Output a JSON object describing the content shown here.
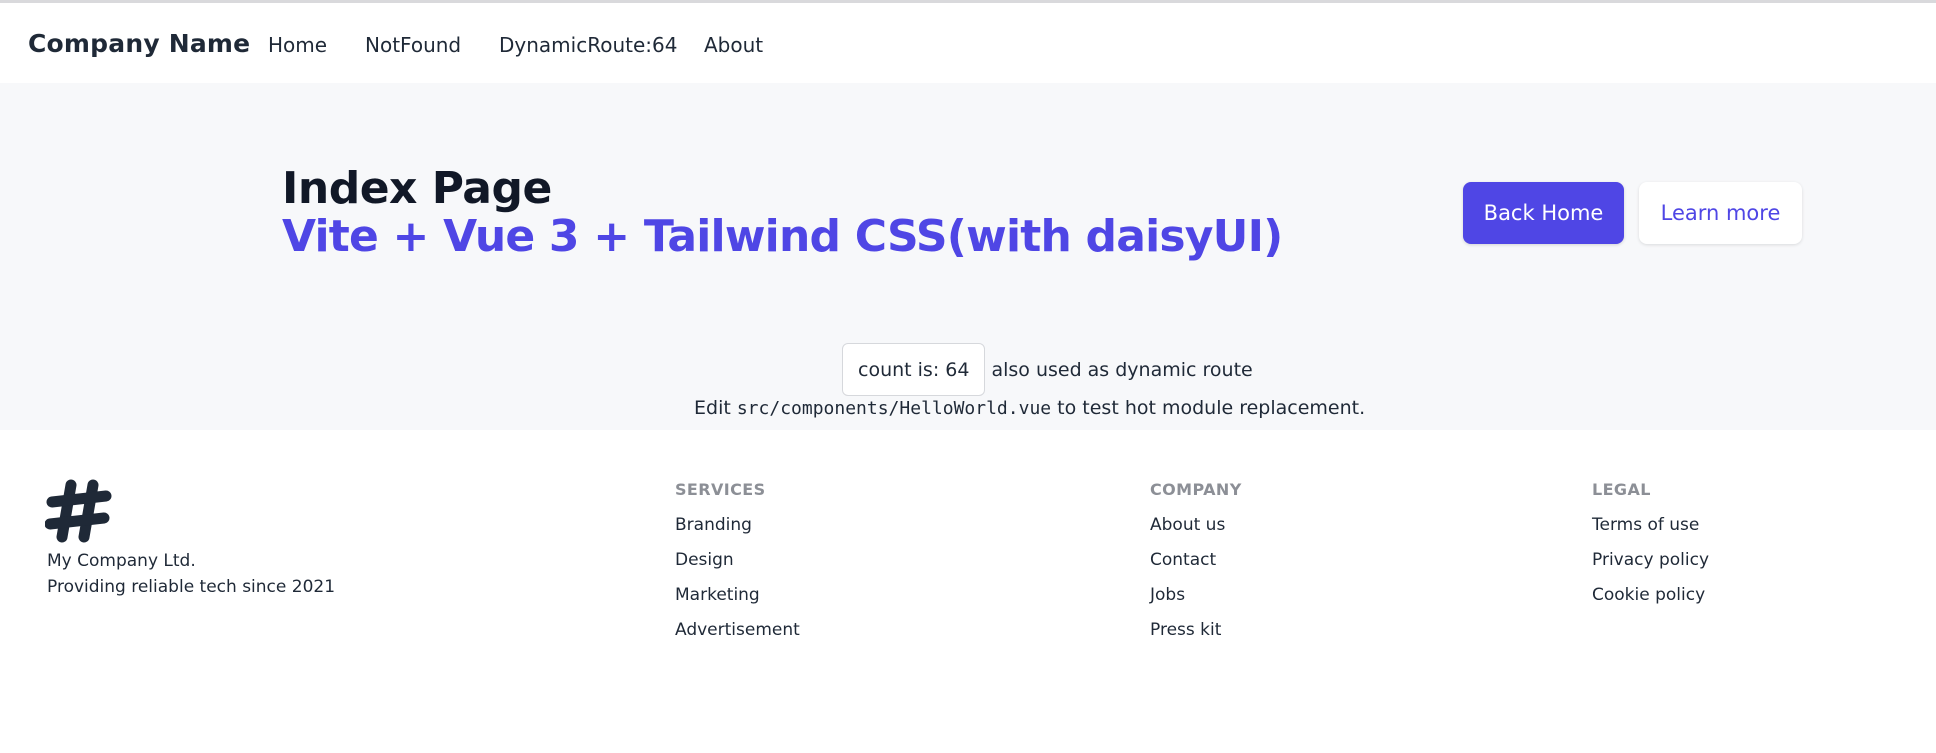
{
  "navbar": {
    "brand": "Company Name",
    "links": [
      "Home",
      "NotFound",
      "DynamicRoute:64",
      "About"
    ]
  },
  "hero": {
    "title": "Index Page",
    "subtitle": "Vite + Vue 3 + Tailwind CSS(with daisyUI)",
    "primary_button": "Back Home",
    "secondary_button": "Learn more"
  },
  "counter": {
    "button_label": "count is: 64",
    "note": "also used as dynamic route"
  },
  "edit": {
    "prefix": "Edit",
    "path": "src/components/HelloWorld.vue",
    "suffix": "to test hot module replacement."
  },
  "footer": {
    "logo_icon": "hash-icon",
    "company_name": "My Company Ltd.",
    "tagline": "Providing reliable tech since 2021",
    "columns": [
      {
        "title": "SERVICES",
        "links": [
          "Branding",
          "Design",
          "Marketing",
          "Advertisement"
        ]
      },
      {
        "title": "COMPANY",
        "links": [
          "About us",
          "Contact",
          "Jobs",
          "Press kit"
        ]
      },
      {
        "title": "LEGAL",
        "links": [
          "Terms of use",
          "Privacy policy",
          "Cookie policy"
        ]
      }
    ]
  },
  "colors": {
    "accent": "#4f46e5",
    "hero_bg": "#f7f8fa",
    "text": "#1f2937"
  }
}
